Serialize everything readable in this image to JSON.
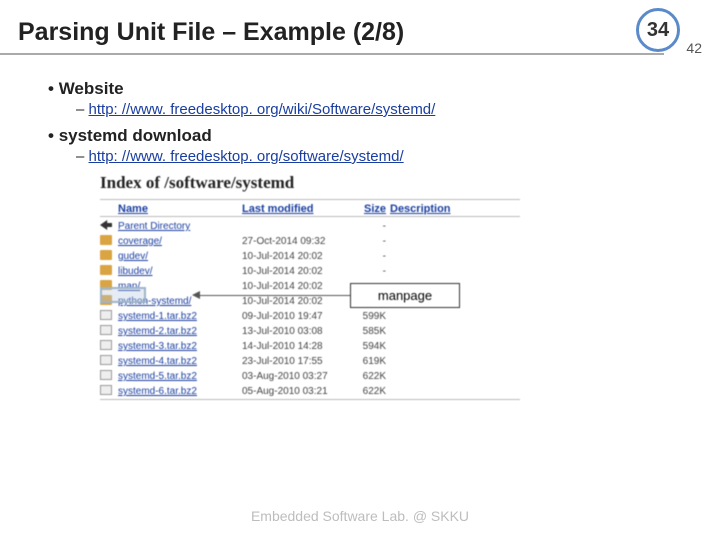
{
  "pageBadge": "34",
  "pageBadgeSub": "42",
  "title": "Parsing Unit File – Example (2/8)",
  "bullets": {
    "b1": "Website",
    "b1link": "http: //www. freedesktop. org/wiki/Software/systemd/",
    "b2": "systemd download",
    "b2link": "http: //www. freedesktop. org/software/systemd/"
  },
  "listing": {
    "heading": "Index of /software/systemd",
    "headers": {
      "name": "Name",
      "mod": "Last modified",
      "size": "Size",
      "desc": "Description"
    },
    "rows": [
      {
        "icon": "back",
        "name": "Parent Directory",
        "mod": "",
        "size": "-"
      },
      {
        "icon": "folder",
        "name": "coverage/",
        "mod": "27-Oct-2014 09:32",
        "size": "-"
      },
      {
        "icon": "folder",
        "name": "gudev/",
        "mod": "10-Jul-2014 20:02",
        "size": "-"
      },
      {
        "icon": "folder",
        "name": "libudev/",
        "mod": "10-Jul-2014 20:02",
        "size": "-"
      },
      {
        "icon": "folder",
        "name": "man/",
        "mod": "10-Jul-2014 20:02",
        "size": "-"
      },
      {
        "icon": "folder",
        "name": "python-systemd/",
        "mod": "10-Jul-2014 20:02",
        "size": "-"
      },
      {
        "icon": "file",
        "name": "systemd-1.tar.bz2",
        "mod": "09-Jul-2010 19:47",
        "size": "599K"
      },
      {
        "icon": "file",
        "name": "systemd-2.tar.bz2",
        "mod": "13-Jul-2010 03:08",
        "size": "585K"
      },
      {
        "icon": "file",
        "name": "systemd-3.tar.bz2",
        "mod": "14-Jul-2010 14:28",
        "size": "594K"
      },
      {
        "icon": "file",
        "name": "systemd-4.tar.bz2",
        "mod": "23-Jul-2010 17:55",
        "size": "619K"
      },
      {
        "icon": "file",
        "name": "systemd-5.tar.bz2",
        "mod": "03-Aug-2010 03:27",
        "size": "622K"
      },
      {
        "icon": "file",
        "name": "systemd-6.tar.bz2",
        "mod": "05-Aug-2010 03:21",
        "size": "622K"
      }
    ]
  },
  "callout": "manpage",
  "footer": "Embedded Software Lab. @ SKKU"
}
